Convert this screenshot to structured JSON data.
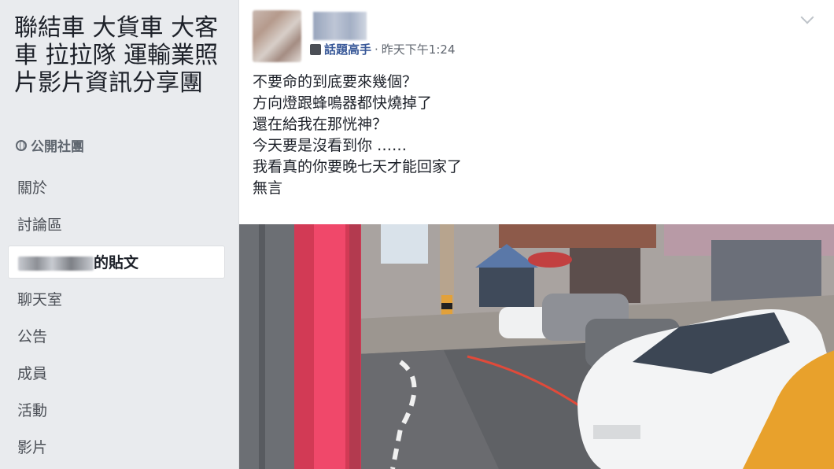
{
  "sidebar": {
    "group_title": "聯結車 大貨車 大客車 拉拉隊 運輸業照片影片資訊分享團",
    "privacy_label": "公開社團",
    "nav": [
      {
        "label": "關於"
      },
      {
        "label": "討論區"
      },
      {
        "label": "的貼文"
      },
      {
        "label": "聊天室"
      },
      {
        "label": "公告"
      },
      {
        "label": "成員"
      },
      {
        "label": "活動"
      },
      {
        "label": "影片"
      }
    ]
  },
  "post": {
    "badge": "話題高手",
    "separator": "·",
    "timestamp": "昨天下午1:24",
    "lines": [
      "不要命的到底要來幾個？",
      "方向燈跟蜂鳴器都快燒掉了",
      "還在給我在那恍神？",
      "今天要是沒看到你 ……",
      "我看真的你要晚七天才能回家了",
      "無言"
    ]
  },
  "colors": {
    "page_bg": "#e9ebee",
    "card_bg": "#ffffff",
    "link_blue": "#385898",
    "text_primary": "#1d2129",
    "text_secondary": "#616770"
  },
  "icons": {
    "privacy": "globe-icon",
    "badge": "badge-icon",
    "menu": "chevron-down-icon"
  }
}
